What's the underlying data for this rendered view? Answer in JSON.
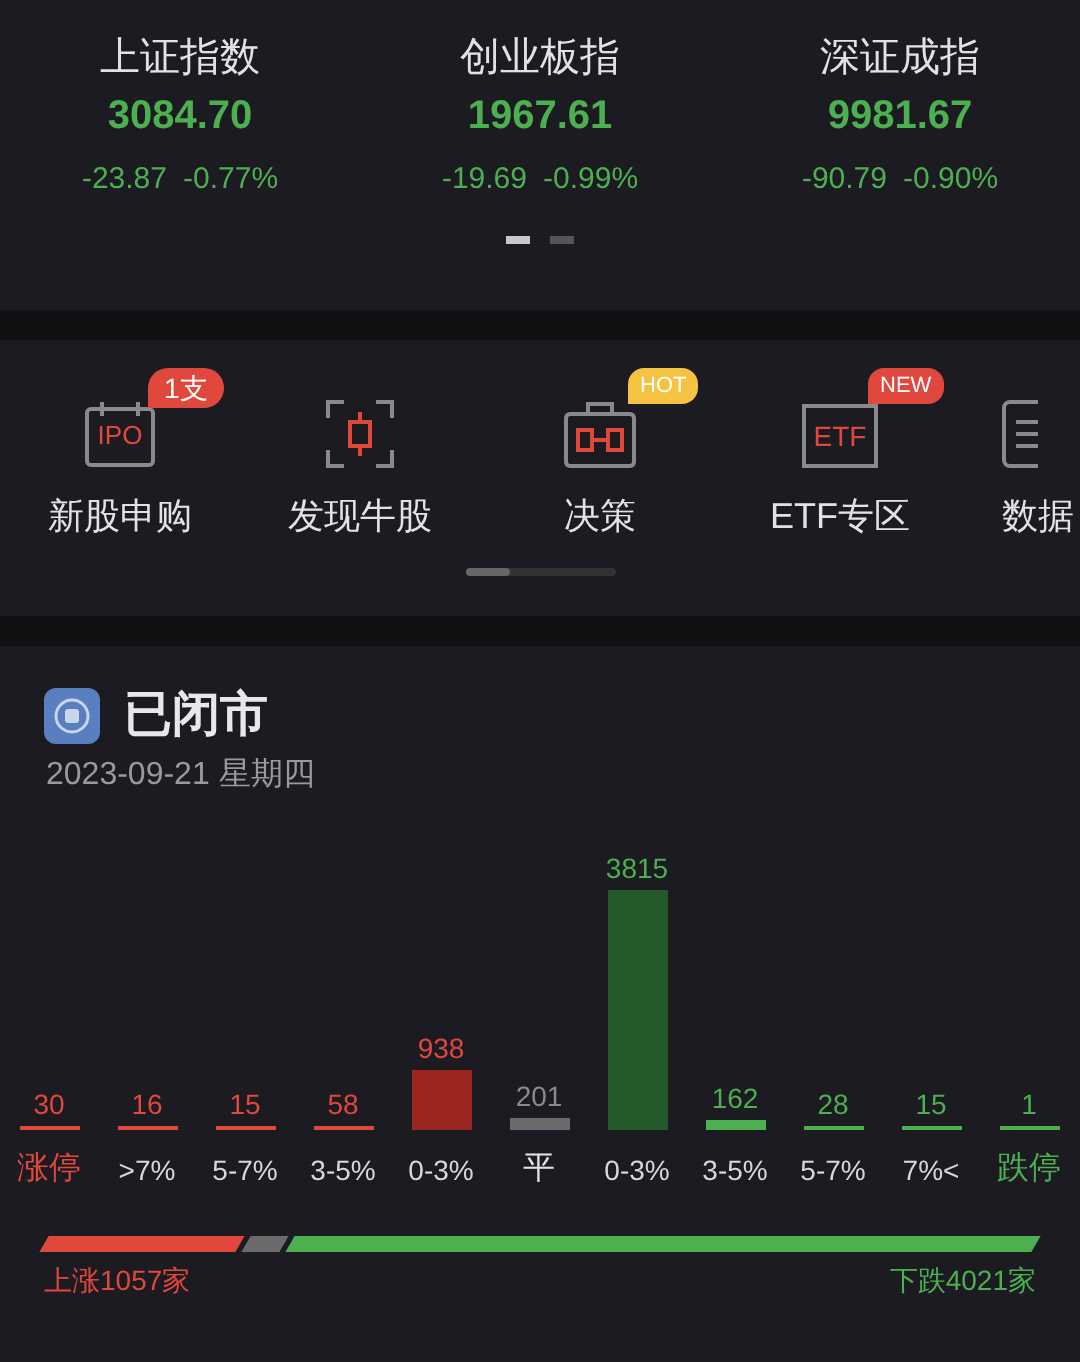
{
  "indices": [
    {
      "name": "上证指数",
      "value": "3084.70",
      "change": "-23.87",
      "percent": "-0.77%"
    },
    {
      "name": "创业板指",
      "value": "1967.61",
      "change": "-19.69",
      "percent": "-0.99%"
    },
    {
      "name": "深证成指",
      "value": "9981.67",
      "change": "-90.79",
      "percent": "-0.90%"
    }
  ],
  "pages": [
    {
      "selected": true
    },
    {
      "selected": false
    }
  ],
  "shortcuts": [
    {
      "label": "新股申购",
      "icon": {
        "kind": "calendar",
        "text": "IPO"
      },
      "badge": {
        "kind": "count",
        "text": "1支"
      }
    },
    {
      "label": "发现牛股",
      "icon": {
        "kind": "scan"
      }
    },
    {
      "label": "决策",
      "icon": {
        "kind": "briefcase"
      },
      "badge": {
        "kind": "hot",
        "text": "HOT"
      }
    },
    {
      "label": "ETF专区",
      "icon": {
        "kind": "box",
        "text": "ETF"
      },
      "badge": {
        "kind": "new",
        "text": "NEW"
      }
    },
    {
      "label": "数据",
      "icon": {
        "kind": "document"
      }
    }
  ],
  "market": {
    "status": "已闭市",
    "date": "2023-09-21 星期四",
    "distribution": [
      {
        "label": "涨停",
        "count": "30",
        "kind": "limit-up"
      },
      {
        "label": ">7%",
        "count": "16",
        "kind": "up"
      },
      {
        "label": "5-7%",
        "count": "15",
        "kind": "up"
      },
      {
        "label": "3-5%",
        "count": "58",
        "kind": "up"
      },
      {
        "label": "0-3%",
        "count": "938",
        "kind": "up"
      },
      {
        "label": "平",
        "count": "201",
        "kind": "flat"
      },
      {
        "label": "0-3%",
        "count": "3815",
        "kind": "down"
      },
      {
        "label": "3-5%",
        "count": "162",
        "kind": "down"
      },
      {
        "label": "5-7%",
        "count": "28",
        "kind": "down"
      },
      {
        "label": "7%<",
        "count": "15",
        "kind": "down"
      },
      {
        "label": "跌停",
        "count": "1",
        "kind": "limit-down"
      }
    ],
    "breadth": {
      "up_label": "上涨1057家",
      "down_label": "下跌4021家"
    }
  }
}
